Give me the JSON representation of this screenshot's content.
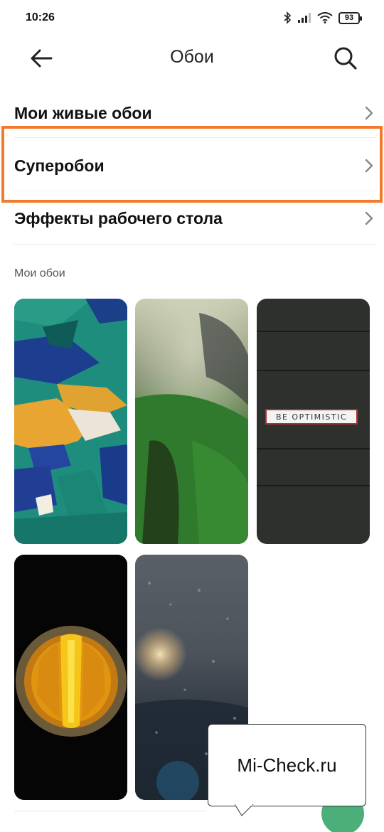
{
  "status_bar": {
    "time": "10:26",
    "battery": "93"
  },
  "header": {
    "title": "Обои"
  },
  "menu": [
    {
      "label": "Мои живые обои"
    },
    {
      "label": "Суперобои"
    },
    {
      "label": "Эффекты рабочего стола"
    }
  ],
  "section_title": "Мои обои",
  "wallpapers": [
    {
      "sign": ""
    },
    {
      "sign": ""
    },
    {
      "sign": "BE OPTIMISTIC"
    },
    {
      "sign": ""
    },
    {
      "sign": ""
    }
  ],
  "watermark": "Mi-Check.ru",
  "colors": {
    "highlight": "#f47a2a",
    "fab": "#4caf7a"
  }
}
